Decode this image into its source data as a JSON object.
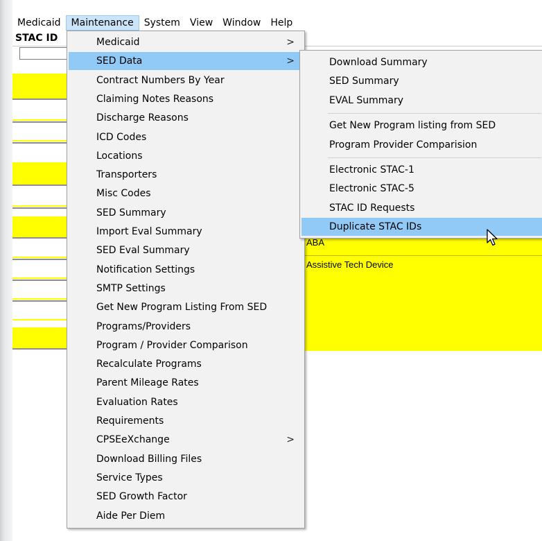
{
  "menubar": {
    "items": [
      "Medicaid",
      "Maintenance",
      "System",
      "View",
      "Window",
      "Help"
    ],
    "active": "Maintenance"
  },
  "grid": {
    "column_header": "STAC ID",
    "row_texts": [
      "ABA",
      "Assistive Tech Device"
    ]
  },
  "maintenance_menu": {
    "items": [
      {
        "label": "Medicaid",
        "has_submenu": true
      },
      {
        "label": "SED Data",
        "has_submenu": true,
        "highlighted": true
      },
      {
        "label": "Contract Numbers By Year"
      },
      {
        "label": "Claiming Notes Reasons"
      },
      {
        "label": "Discharge Reasons"
      },
      {
        "label": "ICD Codes"
      },
      {
        "label": "Locations"
      },
      {
        "label": "Transporters"
      },
      {
        "label": "Misc Codes"
      },
      {
        "label": "SED Summary"
      },
      {
        "label": "Import Eval Summary"
      },
      {
        "label": "SED Eval Summary"
      },
      {
        "label": "Notification Settings"
      },
      {
        "label": "SMTP Settings"
      },
      {
        "label": "Get New Program Listing From SED"
      },
      {
        "label": "Programs/Providers"
      },
      {
        "label": "Program / Provider Comparison"
      },
      {
        "label": "Recalculate Programs"
      },
      {
        "label": "Parent Mileage Rates"
      },
      {
        "label": "Evaluation Rates"
      },
      {
        "label": "Requirements"
      },
      {
        "label": "CPSEeXchange",
        "has_submenu": true
      },
      {
        "label": "Download Billing Files"
      },
      {
        "label": "Service Types"
      },
      {
        "label": "SED Growth Factor"
      },
      {
        "label": "Aide Per Diem"
      }
    ],
    "submenu_arrow": ">"
  },
  "sed_data_submenu": {
    "groups": [
      [
        "Download Summary",
        "SED Summary",
        "EVAL Summary"
      ],
      [
        "Get New Program listing from SED",
        "Program Provider Comparision"
      ],
      [
        "Electronic STAC-1",
        "Electronic STAC-5",
        "STAC ID Requests",
        "Duplicate STAC IDs"
      ]
    ],
    "highlighted": "Duplicate STAC IDs"
  },
  "colors": {
    "highlight_row": "#ffff00",
    "menu_highlight": "#91c9f7",
    "menu_background": "#f2f2f2",
    "menubar_active": "#cce4f7"
  },
  "icons": {
    "submenu": "chevron-right-icon",
    "pointer": "mouse-cursor-icon"
  }
}
